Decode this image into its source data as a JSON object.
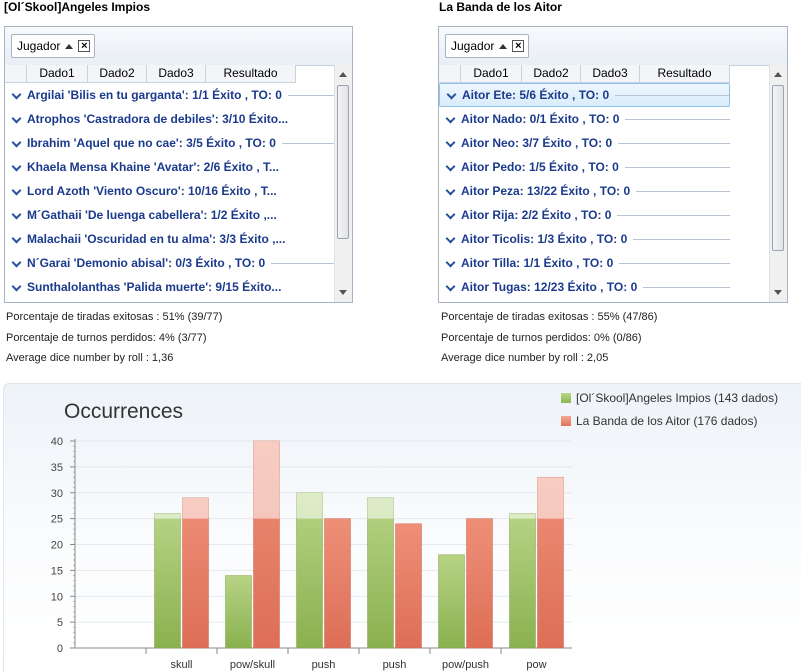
{
  "teams": [
    {
      "title": "[Ol´Skool]Angeles Impios",
      "group_chip": {
        "label": "Jugador",
        "close": "×"
      },
      "columns": [
        "Dado1",
        "Dado2",
        "Dado3",
        "Resultado"
      ],
      "rows": [
        "Argilai 'Bilis en tu garganta':  1/1 Éxito , TO: 0",
        "Atrophos 'Castradora de debiles':  3/10 Éxito...",
        "Ibrahim 'Aquel que no cae':  3/5 Éxito , TO: 0",
        "Khaela Mensa Khaine 'Avatar':  2/6 Éxito , T...",
        "Lord Azoth 'Viento Oscuro':  10/16 Éxito , T...",
        "M´Gathaii 'De luenga cabellera':  1/2 Éxito ,...",
        "Malachaii 'Oscuridad en tu alma':  3/3 Éxito ,...",
        "N´Garai 'Demonio abisal':  0/3 Éxito , TO: 0",
        "Sunthalolanthas 'Palida muerte':  9/15 Éxito..."
      ],
      "stats": [
        "Porcentaje de tiradas exitosas : 51% (39/77)",
        "Porcentaje de turnos perdidos: 4% (3/77)",
        "Average dice number by roll : 1,36"
      ]
    },
    {
      "title": "La Banda de los Aitor",
      "group_chip": {
        "label": "Jugador",
        "close": "×"
      },
      "columns": [
        "Dado1",
        "Dado2",
        "Dado3",
        "Resultado"
      ],
      "rows": [
        "Aitor Ete:  5/6 Éxito , TO: 0",
        "Aitor Nado:  0/1 Éxito , TO: 0",
        "Aitor Neo:  3/7 Éxito , TO: 0",
        "Aitor Pedo:  1/5 Éxito , TO: 0",
        "Aitor Peza:  13/22 Éxito , TO: 0",
        "Aitor Rija:  2/2 Éxito , TO: 0",
        "Aitor Ticolis:  1/3 Éxito , TO: 0",
        "Aitor Tilla:  1/1 Éxito , TO: 0",
        "Aitor Tugas:  12/23 Éxito , TO: 0"
      ],
      "selected_row": 0,
      "stats": [
        "Porcentaje de tiradas exitosas : 55% (47/86)",
        "Porcentaje de turnos perdidos: 0% (0/86)",
        "Average dice number by roll : 2,05"
      ]
    }
  ],
  "icons": {
    "row_expander": "chevron-down-icon",
    "sort": "sort-ascending-icon",
    "remove_group": "close-icon"
  },
  "colors": {
    "series_green": "#9bc15f",
    "series_red": "#e8816a",
    "row_text": "#1b3a8c"
  },
  "chart_data": {
    "type": "bar",
    "title": "Occurrences",
    "categories": [
      "",
      "skull",
      "pow/skull",
      "push",
      "push",
      "pow/push",
      "pow"
    ],
    "series": [
      {
        "name": "[Ol´Skool]Angeles Impios (143 dados)",
        "color": "#9bc15f",
        "values": [
          null,
          26,
          14,
          30,
          29,
          18,
          26
        ]
      },
      {
        "name": "La Banda de los Aitor (176 dados)",
        "color": "#e8816a",
        "values": [
          null,
          29,
          40,
          25,
          24,
          25,
          33
        ]
      }
    ],
    "ylim": [
      0,
      40
    ],
    "yticks": [
      0,
      5,
      10,
      15,
      20,
      25,
      30,
      35,
      40
    ],
    "grid": true,
    "legend": "top-right"
  }
}
